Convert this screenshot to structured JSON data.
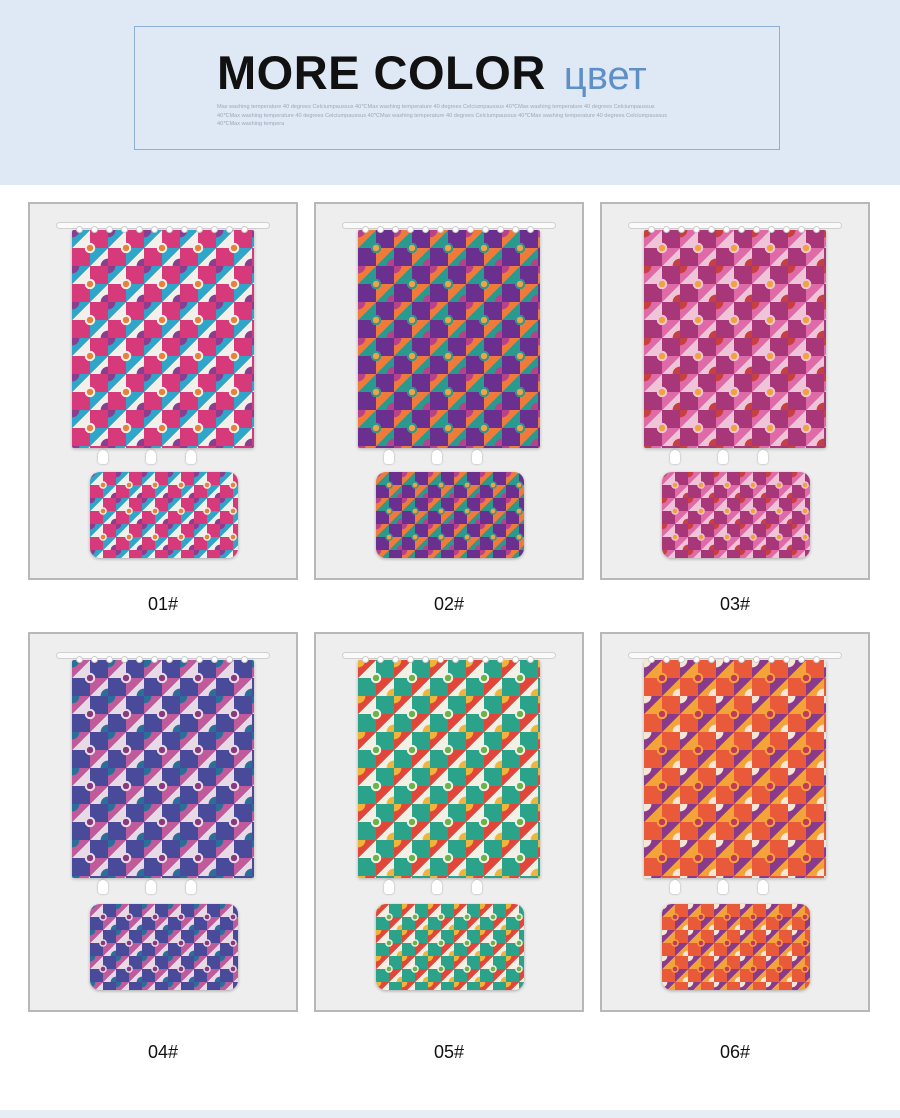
{
  "banner": {
    "title": "MORE COLOR",
    "subtitle": "цвет",
    "fine_print": "Max washing temperature 40 degrees Celciumpaussus 40℃Max washing temperature 40 degrees Celciumpaussus 40℃Max washing temperature 40 degrees Celciumpaussus 40℃Max washing temperature 40 degrees Celciumpaussus 40℃Max washing temperature 40 degrees Celciumpaussus 40℃Max washing temperature 40 degrees Celciumpaussus 40℃Max washing tempera"
  },
  "products": [
    {
      "label": "01#",
      "colors": [
        "#d63a7a",
        "#2fa6c9",
        "#f2f0ea",
        "#8a3e8f",
        "#e8823a"
      ]
    },
    {
      "label": "02#",
      "colors": [
        "#6a2f8f",
        "#ef7a3a",
        "#2a9a8f",
        "#b8428a",
        "#f0a24a"
      ]
    },
    {
      "label": "03#",
      "colors": [
        "#a8377a",
        "#e06aa8",
        "#f0c4d8",
        "#c73f3f",
        "#f2a23a"
      ]
    },
    {
      "label": "04#",
      "colors": [
        "#4a4a9a",
        "#c05a9a",
        "#e8d9e6",
        "#2a6f9a",
        "#8a3a7a"
      ]
    },
    {
      "label": "05#",
      "colors": [
        "#2aa38a",
        "#e0463a",
        "#f2efe4",
        "#f0b43a",
        "#6bb24a"
      ]
    },
    {
      "label": "06#",
      "colors": [
        "#e85a3a",
        "#8a3a8a",
        "#f4a23a",
        "#f6e6d8",
        "#c23a5a"
      ]
    }
  ]
}
